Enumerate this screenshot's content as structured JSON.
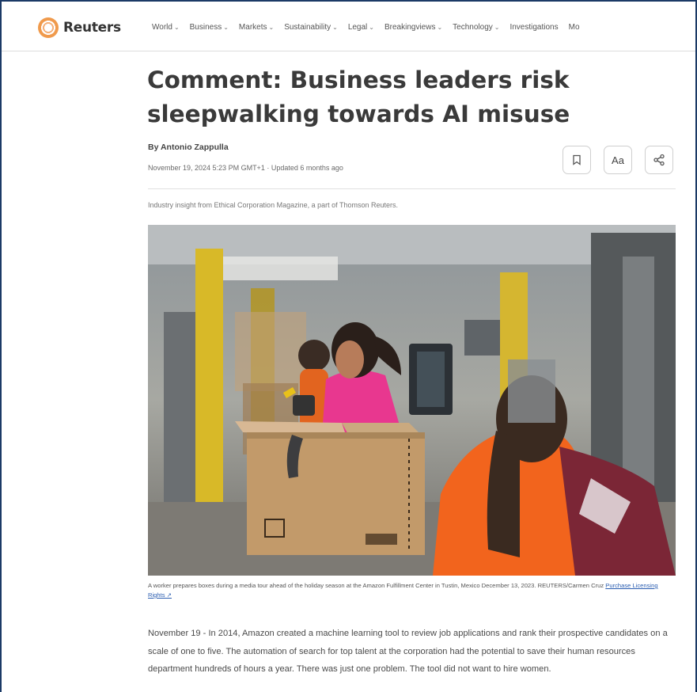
{
  "brand": {
    "name": "Reuters"
  },
  "nav": {
    "items": [
      {
        "label": "World",
        "dropdown": true
      },
      {
        "label": "Business",
        "dropdown": true
      },
      {
        "label": "Markets",
        "dropdown": true
      },
      {
        "label": "Sustainability",
        "dropdown": true
      },
      {
        "label": "Legal",
        "dropdown": true
      },
      {
        "label": "Breakingviews",
        "dropdown": true
      },
      {
        "label": "Technology",
        "dropdown": true
      },
      {
        "label": "Investigations",
        "dropdown": false
      },
      {
        "label": "Mo",
        "dropdown": false
      }
    ]
  },
  "article": {
    "headline": "Comment: Business leaders risk sleepwalking towards AI misuse",
    "byline": "By Antonio Zappulla",
    "dateline": "November 19, 2024 5:23 PM GMT+1 · Updated 6 months ago",
    "intro": "Industry insight from Ethical Corporation Magazine, a part of Thomson Reuters.",
    "tools": {
      "bookmark_icon": "bookmark-icon",
      "text_size_label": "Aa",
      "share_icon": "share-icon"
    },
    "caption": "A worker prepares boxes during a media tour ahead of the holiday season at the Amazon Fulfillment Center in Tustin, Mexico December 13, 2023. REUTERS/Carmen Cruz",
    "license_link": "Purchase Licensing Rights ↗",
    "body": "November 19 - In 2014, Amazon created a machine learning tool to review job applications and rank their prospective candidates on a scale of one to five. The automation of search for top talent at the corporation had the potential to save their human resources department hundreds of hours a year. There was just one problem. The tool did not want to hire women."
  },
  "colors": {
    "frame": "#1b3a66",
    "logo_orange": "#f09a4c",
    "link": "#2a5db0",
    "vest_orange": "#f2641d",
    "shirt_pink": "#e8378f"
  }
}
